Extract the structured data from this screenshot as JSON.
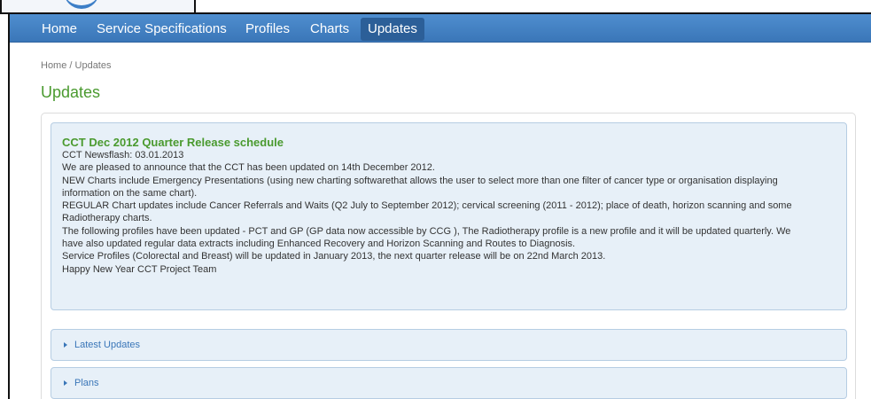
{
  "nav": {
    "items": [
      {
        "label": "Home"
      },
      {
        "label": "Service Specifications"
      },
      {
        "label": "Profiles"
      },
      {
        "label": "Charts"
      },
      {
        "label": "Updates",
        "active": true
      }
    ]
  },
  "breadcrumb": "Home / Updates",
  "page_title": "Updates",
  "news": {
    "title": "CCT Dec 2012 Quarter Release schedule",
    "lines": [
      "CCT Newsflash: 03.01.2013",
      "We are pleased to announce that the CCT has been updated on 14th December 2012.",
      "NEW Charts include Emergency Presentations (using new charting softwarethat allows the user to select more than one filter of cancer type or organisation displaying",
      "information on the same chart).",
      "REGULAR Chart updates include Cancer Referrals and Waits (Q2 July to September 2012); cervical screening (2011 - 2012); place of death, horizon scanning and some",
      "Radiotherapy charts.",
      "The following profiles have been updated - PCT and GP (GP data now accessible by CCG ), The Radiotherapy profile is a new profile and it will be updated quarterly. We",
      "have also updated regular data extracts including Enhanced Recovery and Horizon Scanning and Routes to Diagnosis.",
      "Service Profiles (Colorectal and Breast) will be updated in January 2013, the next quarter release will be on 22nd March 2013.",
      "Happy New Year CCT Project Team"
    ]
  },
  "accordion": {
    "latest_updates": "Latest Updates",
    "plans": "Plans"
  },
  "colors": {
    "nav_bg": "#3a76b8",
    "title_green": "#4a9a2f",
    "panel_bg": "#e7f0f8"
  }
}
